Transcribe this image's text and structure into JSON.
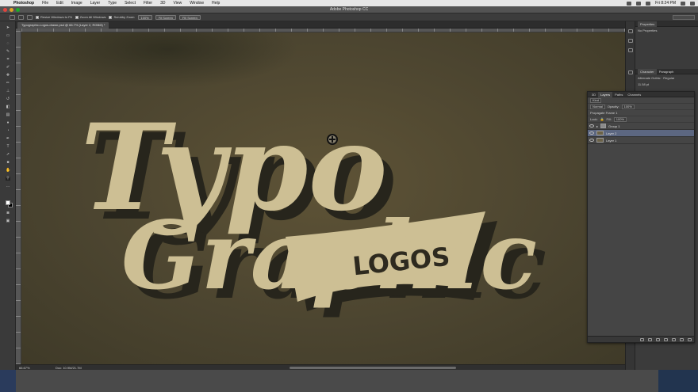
{
  "menubar": {
    "app_name": "Photoshop",
    "items": [
      "File",
      "Edit",
      "Image",
      "Layer",
      "Type",
      "Select",
      "Filter",
      "3D",
      "View",
      "Window",
      "Help"
    ],
    "clock": "Fri 8:24 PM"
  },
  "window": {
    "title": "Adobe Photoshop CC"
  },
  "options_bar": {
    "resize_windows": "Resize Windows to Fit",
    "zoom_all": "Zoom All Windows",
    "scrubby_zoom": "Scrubby Zoom",
    "btn_100": "100%",
    "btn_fit": "Fit Screen",
    "btn_fill": "Fill Screen"
  },
  "document": {
    "tab_label": "Typographic-Logos-drawn.psd @ 66.7% (Layer 2, RGB/8) *",
    "zoom": "66.67%",
    "doc_info": "Doc: 10.9M/21.7M"
  },
  "artwork": {
    "line1": "Typo",
    "line2": "Graphic",
    "banner": "LOGOS",
    "colors": {
      "background": "#4e4631",
      "text": "#cdbf94",
      "shadow": "#27251c",
      "banner_text": "#2e2a1f"
    }
  },
  "properties_panel": {
    "tab": "Properties",
    "message": "No Properties"
  },
  "character_panel": {
    "tabs": [
      "Character",
      "Paragraph"
    ],
    "font": "Alternate Gothic",
    "style": "Regular",
    "size": "11.58 pt"
  },
  "layers_panel": {
    "tabs": [
      "3D",
      "Layers",
      "Paths",
      "Channels"
    ],
    "filter_kind": "Kind",
    "blend_mode": "Normal",
    "opacity_label": "Opacity:",
    "opacity": "100%",
    "lock_label": "Lock:",
    "fill_label": "Fill:",
    "fill": "100%",
    "propagate": "Propagate Frame 1",
    "layers": [
      {
        "name": "Group 1",
        "type": "group",
        "selected": false
      },
      {
        "name": "Layer 2",
        "type": "layer",
        "selected": true
      },
      {
        "name": "Layer 1",
        "type": "layer",
        "selected": false
      }
    ]
  }
}
